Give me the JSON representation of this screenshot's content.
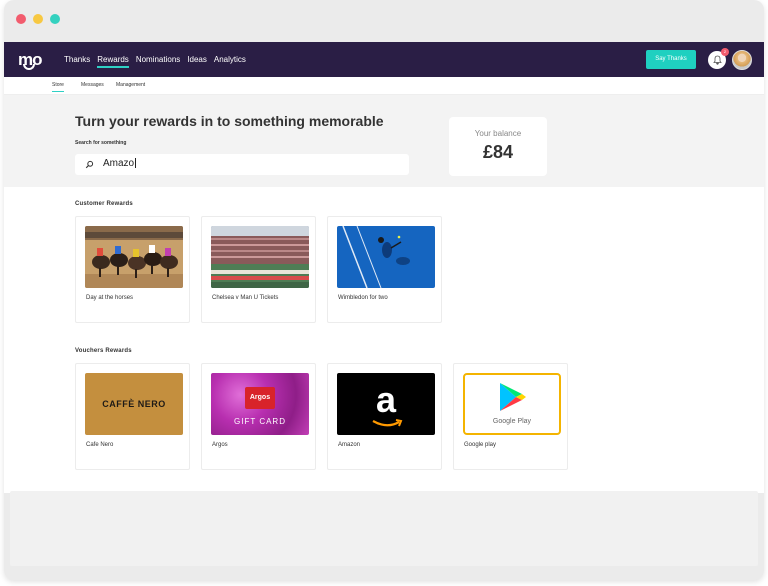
{
  "nav": {
    "logo": "mo",
    "links": [
      "Thanks",
      "Rewards",
      "Nominations",
      "Ideas",
      "Analytics"
    ],
    "say_thanks": "Say Thanks",
    "bell_badge": "2"
  },
  "subnav": [
    "Store",
    "Messages",
    "Management"
  ],
  "hero": {
    "title": "Turn your rewards in to something memorable",
    "search_label": "Search for something",
    "search_value": "Amazo"
  },
  "balance": {
    "label": "Your balance",
    "value": "£84"
  },
  "sections": {
    "customer_title": "Customer Rewards",
    "customer_items": [
      "Day at the horses",
      "Chelsea  v Man U Tickets",
      "Wimbledon for two"
    ],
    "voucher_title": "Vouchers Rewards",
    "voucher_items": [
      "Cafe Nero",
      "Argos",
      "Amazon",
      "Google play"
    ]
  },
  "logos": {
    "cafe_nero": "CAFFÈ NERO",
    "argos": "Argos",
    "gift_card": "GIFT CARD",
    "amazon": "a",
    "google_play": "Google Play"
  },
  "colors": {
    "brand": "#2a1e45",
    "accent": "#1fd0c0",
    "badge": "#f25c6e"
  }
}
